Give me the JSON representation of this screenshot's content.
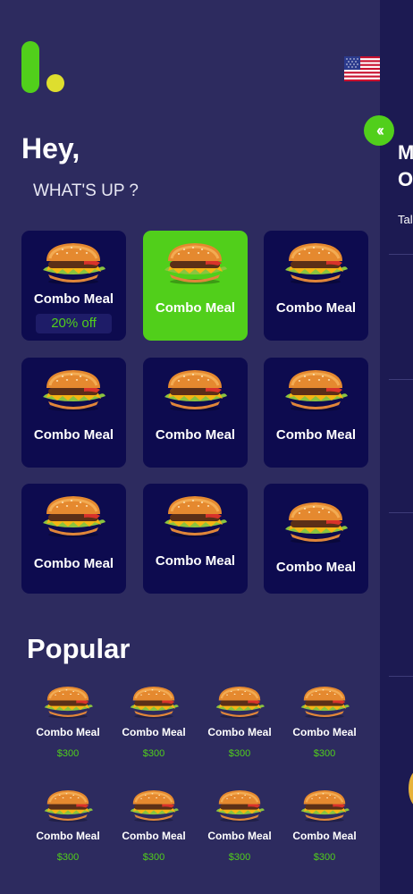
{
  "header": {
    "language_flag": "us-flag-icon",
    "collapse_icon": "double-chevron-left-icon"
  },
  "greeting": {
    "title": "Hey,",
    "subtitle": "WHAT'S UP ?"
  },
  "categories": [
    {
      "label": "Combo Meal",
      "badge": "20% off"
    },
    {
      "label": "Combo Meal",
      "active": true
    },
    {
      "label": "Combo Meal"
    },
    {
      "label": "Combo Meal"
    },
    {
      "label": "Combo Meal"
    },
    {
      "label": "Combo Meal"
    },
    {
      "label": "Combo Meal"
    },
    {
      "label": "Combo Meal"
    },
    {
      "label": "Combo Meal"
    }
  ],
  "popular": {
    "title": "Popular",
    "items": [
      {
        "name": "Combo Meal",
        "price": "$300"
      },
      {
        "name": "Combo Meal",
        "price": "$300"
      },
      {
        "name": "Combo Meal",
        "price": "$300"
      },
      {
        "name": "Combo Meal",
        "price": "$300"
      },
      {
        "name": "Combo Meal",
        "price": "$300"
      },
      {
        "name": "Combo Meal",
        "price": "$300"
      },
      {
        "name": "Combo Meal",
        "price": "$300"
      },
      {
        "name": "Combo Meal",
        "price": "$300"
      }
    ]
  },
  "side_panel": {
    "title": "M\nO",
    "subtitle": "Tal"
  },
  "colors": {
    "background": "#2d2b5f",
    "tile": "#0d0b4f",
    "accent": "#51cf1b",
    "logo_dot": "#dede2e",
    "side_panel": "#1c1a52"
  }
}
